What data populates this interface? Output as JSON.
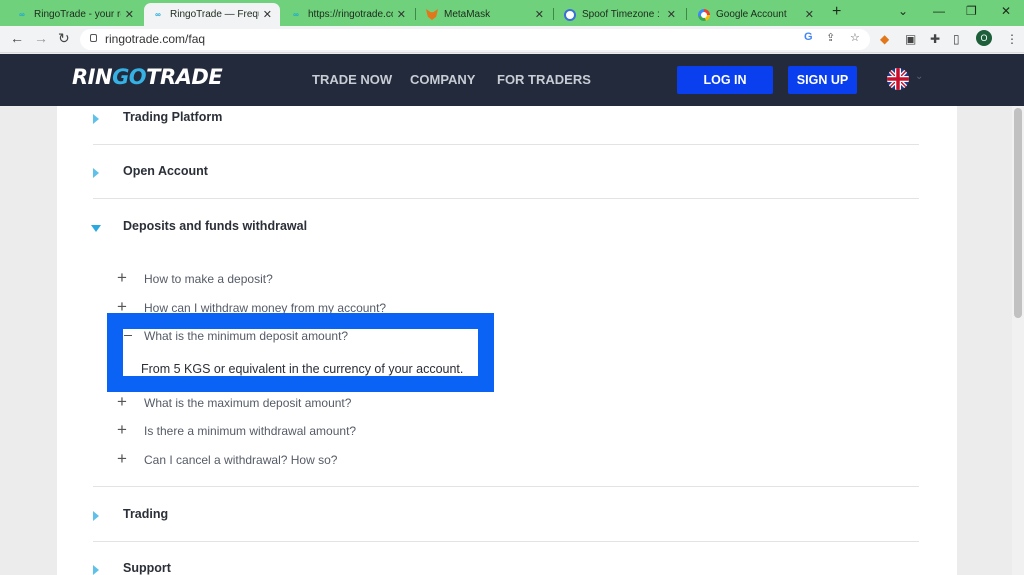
{
  "browser": {
    "tabs": [
      {
        "title": "RingoTrade - your reli",
        "icon": "go-favicon"
      },
      {
        "title": "RingoTrade — Freque",
        "icon": "go-favicon"
      },
      {
        "title": "https://ringotrade.com",
        "icon": "go-favicon"
      },
      {
        "title": "MetaMask",
        "icon": "fox-favicon"
      },
      {
        "title": "Spoof Timezone : ad",
        "icon": "globe-favicon"
      },
      {
        "title": "Google Account",
        "icon": "google-favicon"
      }
    ],
    "url": "ringotrade.com/faq",
    "profile_initial": "O",
    "tab_strip_color": "#6fd17b"
  },
  "header": {
    "logo_prefix": "RIN",
    "logo_accent": "GO",
    "logo_suffix": "TRADE",
    "nav": [
      "TRADE NOW",
      "COMPANY",
      "FOR TRADERS"
    ],
    "login_label": "LOG IN",
    "signup_label": "SIGN UP",
    "accent_color": "#0a3ff0",
    "bg_color": "#232a3b",
    "language_icon": "uk-flag-icon"
  },
  "faq": {
    "categories": [
      {
        "label": "Trading Platform",
        "expanded": false
      },
      {
        "label": "Open Account",
        "expanded": false
      },
      {
        "label": "Deposits and funds withdrawal",
        "expanded": true
      },
      {
        "label": "Trading",
        "expanded": false
      },
      {
        "label": "Support",
        "expanded": false
      }
    ],
    "questions": [
      {
        "text": "How to make a deposit?",
        "open": false
      },
      {
        "text": "How can I withdraw money from my account?",
        "open": false
      },
      {
        "text": "What is the minimum deposit amount?",
        "open": true
      },
      {
        "text": "What is the maximum deposit amount?",
        "open": false
      },
      {
        "text": "Is there a minimum withdrawal amount?",
        "open": false
      },
      {
        "text": "Can I cancel a withdrawal? How so?",
        "open": false
      }
    ],
    "answer": "From 5 KGS or equivalent in the currency of your account.",
    "highlight_color": "#0a63f5"
  }
}
